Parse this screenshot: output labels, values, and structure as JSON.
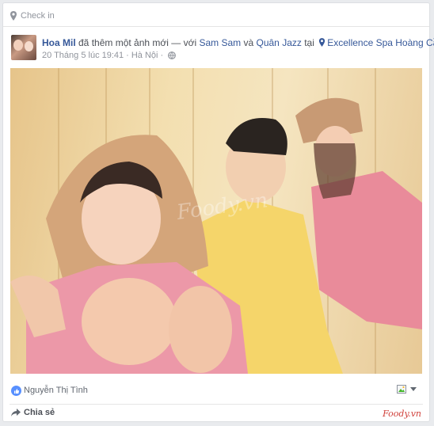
{
  "post": {
    "checkin_label": "Check in",
    "author": "Hoa Mil",
    "action_text": " đã thêm một ảnh mới — với ",
    "tag1": "Sam Sam",
    "and_text": " và ",
    "tag2": "Quân Jazz",
    "at_text": " tại ",
    "place": "Excellence Spa Hoàng Cầu",
    "period": ".",
    "timestamp": "20 Tháng 5 lúc 19:41",
    "location": "Hà Nội",
    "separator": "·",
    "privacy_icon": "globe-icon"
  },
  "photo": {
    "watermark": "Foody.vn",
    "description_icon": "photo-three-friends-sauna"
  },
  "reactions": {
    "liker": "Nguyễn Thị Tình",
    "icon": "like-icon"
  },
  "actions": {
    "share_label": "Chia sẻ"
  },
  "footer": {
    "watermark": "Foody.vn"
  },
  "colors": {
    "link": "#365899",
    "like_badge": "#5890ff",
    "watermark": "#d0403a"
  }
}
